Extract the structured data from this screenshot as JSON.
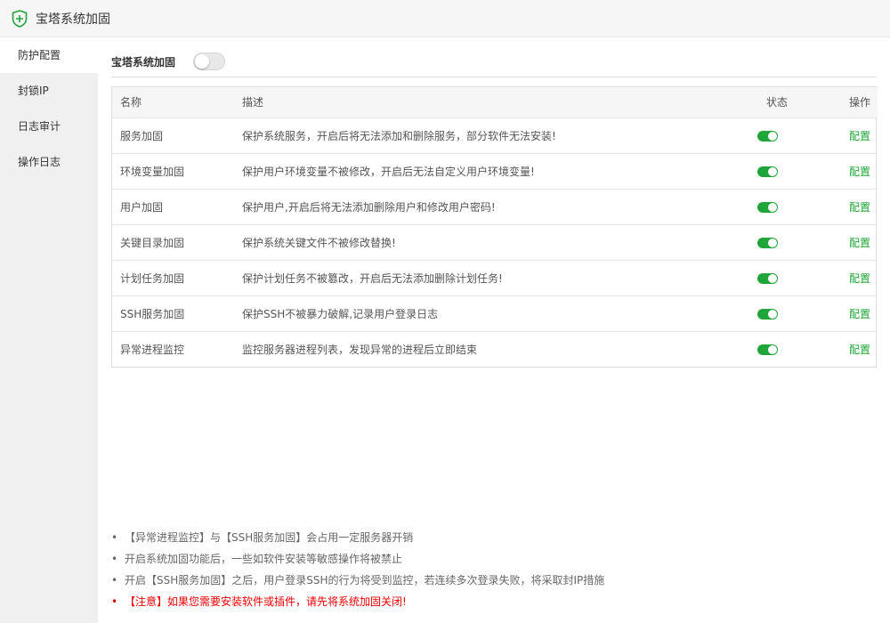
{
  "app": {
    "title": "宝塔系统加固",
    "accent": "#20a53a"
  },
  "sidebar": {
    "items": [
      {
        "label": "防护配置",
        "active": true
      },
      {
        "label": "封锁IP"
      },
      {
        "label": "日志审计"
      },
      {
        "label": "操作日志"
      }
    ]
  },
  "main": {
    "toggle_label": "宝塔系统加固",
    "toggle_on": false,
    "table": {
      "headers": {
        "name": "名称",
        "desc": "描述",
        "status": "状态",
        "action": "操作"
      },
      "rows": [
        {
          "name": "服务加固",
          "desc": "保护系统服务，开启后将无法添加和删除服务，部分软件无法安装!",
          "status": true,
          "action": "配置"
        },
        {
          "name": "环境变量加固",
          "desc": "保护用户环境变量不被修改，开启后无法自定义用户环境变量!",
          "status": true,
          "action": "配置"
        },
        {
          "name": "用户加固",
          "desc": "保护用户,开启后将无法添加删除用户和修改用户密码!",
          "status": true,
          "action": "配置"
        },
        {
          "name": "关键目录加固",
          "desc": "保护系统关键文件不被修改替换!",
          "status": true,
          "action": "配置"
        },
        {
          "name": "计划任务加固",
          "desc": "保护计划任务不被篡改，开启后无法添加删除计划任务!",
          "status": true,
          "action": "配置"
        },
        {
          "name": "SSH服务加固",
          "desc": "保护SSH不被暴力破解,记录用户登录日志",
          "status": true,
          "action": "配置"
        },
        {
          "name": "异常进程监控",
          "desc": "监控服务器进程列表，发现异常的进程后立即结束",
          "status": true,
          "action": "配置"
        }
      ]
    }
  },
  "notes": [
    "【异常进程监控】与【SSH服务加固】会占用一定服务器开销",
    "开启系统加固功能后，一些如软件安装等敏感操作将被禁止",
    "开启【SSH服务加固】之后，用户登录SSH的行为将受到监控，若连续多次登录失败，将采取封IP措施",
    "【注意】如果您需要安装软件或插件，请先将系统加固关闭!"
  ]
}
